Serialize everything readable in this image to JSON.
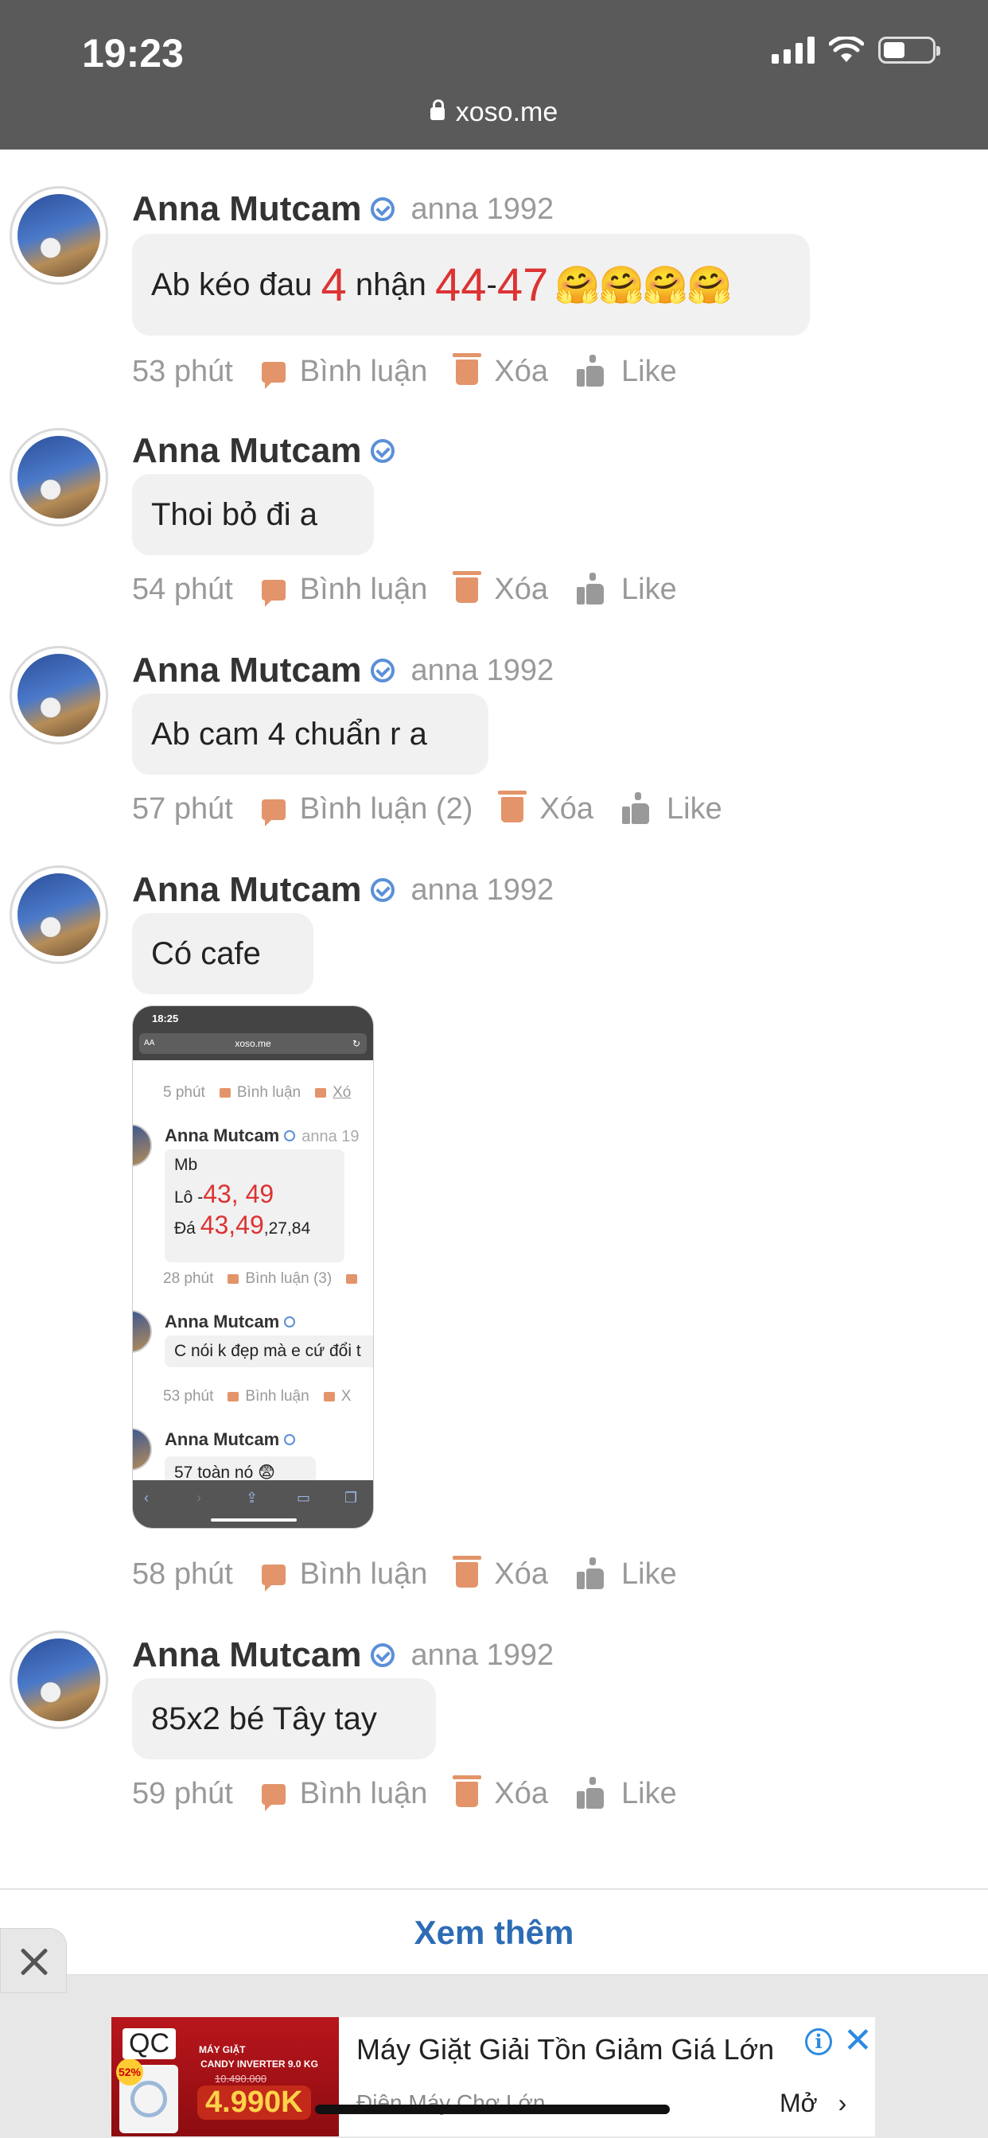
{
  "status_bar": {
    "time": "19:23",
    "url": "xoso.me"
  },
  "comments": [
    {
      "name": "Anna Mutcam",
      "username": "anna 1992",
      "text_a": "Ab kéo đau ",
      "num_a": "4",
      "text_b": " nhận ",
      "num_b": "44",
      "dash": "-",
      "num_c": "47",
      "emoji": "🤗🤗🤗🤗",
      "time": "53 phút",
      "comment_label": "Bình luận",
      "delete_label": "Xóa",
      "like_label": "Like"
    },
    {
      "name": "Anna Mutcam",
      "text": "Thoi bỏ đi a",
      "time": "54 phút",
      "comment_label": "Bình luận",
      "delete_label": "Xóa",
      "like_label": "Like"
    },
    {
      "name": "Anna Mutcam",
      "username": "anna 1992",
      "text": "Ab cam 4 chuẩn r a",
      "time": "57 phút",
      "comment_label": "Bình luận (2)",
      "delete_label": "Xóa",
      "like_label": "Like"
    },
    {
      "name": "Anna Mutcam",
      "username": "anna 1992",
      "text": "Có cafe",
      "time": "58 phút",
      "comment_label": "Bình luận",
      "delete_label": "Xóa",
      "like_label": "Like"
    },
    {
      "name": "Anna Mutcam",
      "username": "anna 1992",
      "text": "85x2 bé Tây tay",
      "time": "59 phút",
      "comment_label": "Bình luận",
      "delete_label": "Xóa",
      "like_label": "Like"
    }
  ],
  "embedded_screenshot": {
    "time": "18:25",
    "aa": "AA",
    "url": "xoso.me",
    "row1_time": "5 phút",
    "row1_comment": "Bình luận",
    "row1_delete": "Xó",
    "name1": "Anna Mutcam",
    "user1": "anna 19",
    "line_mb": "Mb",
    "lo_prefix": "Lô -",
    "lo_nums": "43, 49",
    "da_prefix": "Đá ",
    "da_nums": "43,49",
    "da_rest": ",27,84",
    "row2_time": "28 phút",
    "row2_comment": "Bình luận (3)",
    "name2": "Anna Mutcam",
    "text2": "C nói k đẹp mà e cứ đổi t",
    "row3_time": "53 phút",
    "row3_comment": "Bình luận",
    "row3_delete": "X",
    "name3": "Anna Mutcam",
    "text3": "57 toàn nó 😨"
  },
  "load_more": "Xem thêm",
  "ad": {
    "qc": "QC",
    "badge": "52%",
    "img_line1": "MÁY GIẶT",
    "img_line2": "CANDY INVERTER 9.0 KG",
    "img_old_price": "10.490.000",
    "img_price": "4.990K",
    "title": "Máy Giặt Giải Tồn Giảm Giá Lớn",
    "advertiser": "Điện Máy Chợ Lớn",
    "open_label": "Mở",
    "info_icon": "i"
  }
}
